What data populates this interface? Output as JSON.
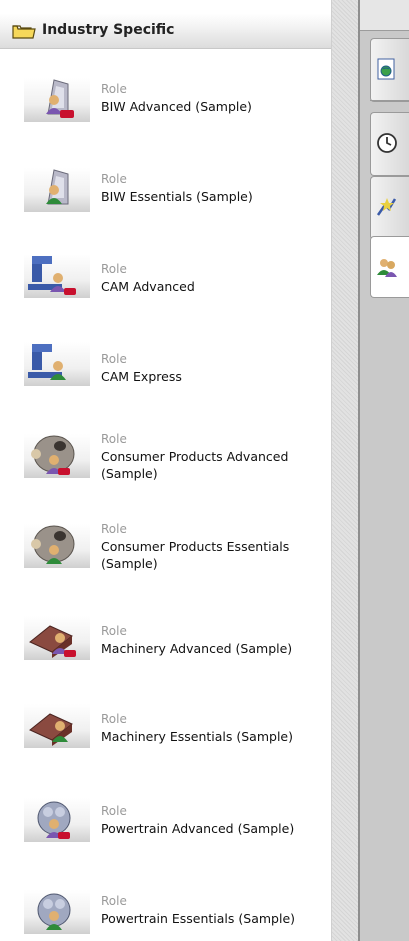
{
  "section": {
    "title": "Industry Specific"
  },
  "roles": [
    {
      "type": "Role",
      "name": "BIW Advanced (Sample)",
      "icon": "biw-advanced-icon"
    },
    {
      "type": "Role",
      "name": "BIW Essentials (Sample)",
      "icon": "biw-essentials-icon"
    },
    {
      "type": "Role",
      "name": "CAM Advanced",
      "icon": "cam-advanced-icon"
    },
    {
      "type": "Role",
      "name": "CAM Express",
      "icon": "cam-express-icon"
    },
    {
      "type": "Role",
      "name": "Consumer Products Advanced (Sample)",
      "icon": "consumer-products-advanced-icon"
    },
    {
      "type": "Role",
      "name": "Consumer Products Essentials (Sample)",
      "icon": "consumer-products-essentials-icon"
    },
    {
      "type": "Role",
      "name": "Machinery Advanced (Sample)",
      "icon": "machinery-advanced-icon"
    },
    {
      "type": "Role",
      "name": "Machinery Essentials (Sample)",
      "icon": "machinery-essentials-icon"
    },
    {
      "type": "Role",
      "name": "Powertrain Advanced (Sample)",
      "icon": "powertrain-advanced-icon"
    },
    {
      "type": "Role",
      "name": "Powertrain Essentials (Sample)",
      "icon": "powertrain-essentials-icon"
    }
  ],
  "resource_bar": {
    "tabs": [
      {
        "name": "web-browser-tab",
        "icon": "web-browser-icon"
      },
      {
        "name": "history-tab",
        "icon": "clock-icon"
      },
      {
        "name": "system-materials-tab",
        "icon": "system-materials-icon"
      },
      {
        "name": "roles-tab",
        "icon": "roles-icon",
        "active": true
      }
    ]
  }
}
